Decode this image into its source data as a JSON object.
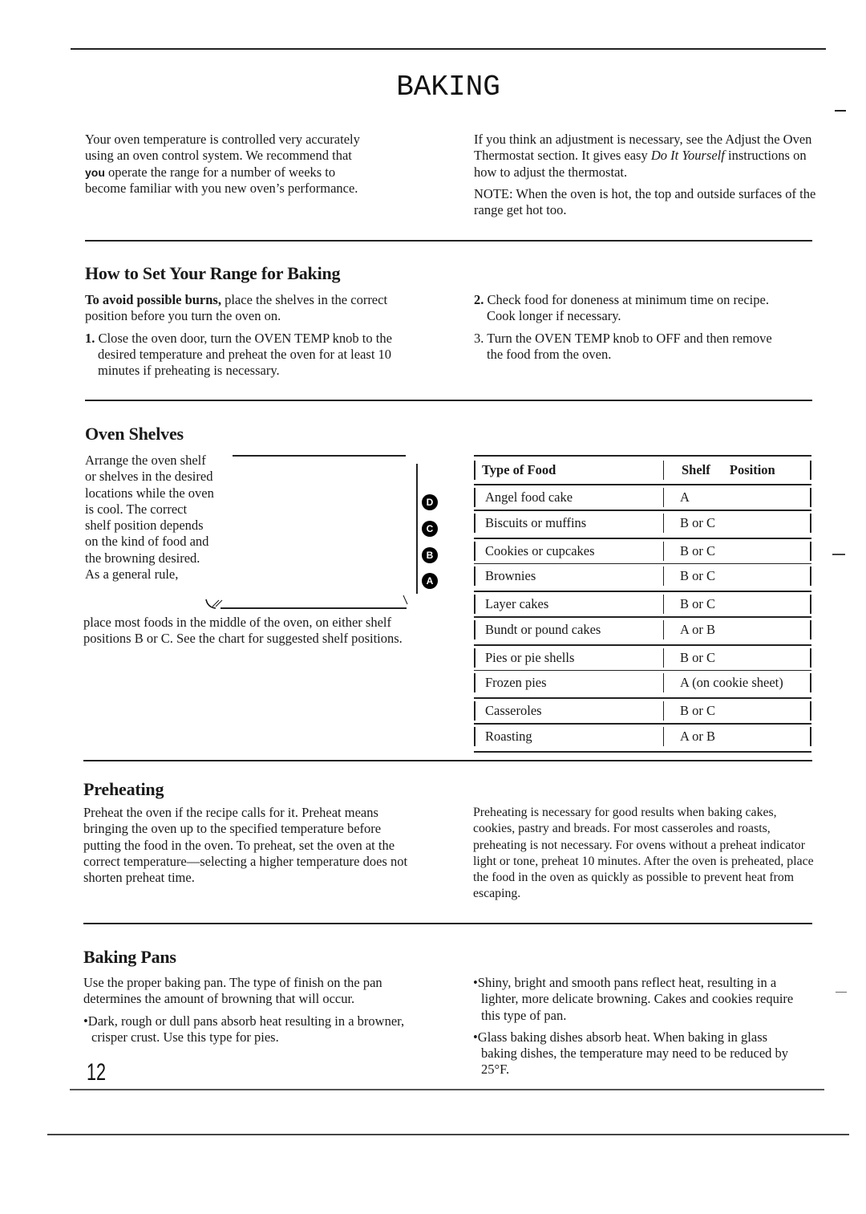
{
  "page": {
    "title": "BAKING",
    "page_number": "12"
  },
  "intro": {
    "left_line1": "Your oven temperature is controlled very accurately",
    "left_line2": "using an oven control system. We recommend that",
    "left_you": "you",
    "left_line3_rest": " operate the range for a number of weeks to",
    "left_line4": "become familiar with you new oven’s performance.",
    "right_p1_a": "If you think an adjustment is necessary, see the Adjust the Oven Thermostat section. It gives easy ",
    "right_p1_italic": "Do It Yourself",
    "right_p1_b": " instructions on how to adjust the thermostat.",
    "right_note": "NOTE: When the oven is hot, the top and outside surfaces of the range get hot too."
  },
  "how_to_set": {
    "heading": "How to Set Your Range for Baking",
    "warning_bold": "To avoid possible burns,",
    "warning_rest": " place the shelves in the correct position before you turn the oven on.",
    "steps": [
      {
        "num": "1.",
        "text": "Close the oven door, turn the OVEN TEMP knob to the desired temperature and preheat the oven for at least 10 minutes if preheating is necessary."
      },
      {
        "num": "2.",
        "text": "Check food for doneness at minimum time on recipe. Cook longer if necessary."
      },
      {
        "num": "3.",
        "text": "Turn the OVEN TEMP knob to OFF and then remove the food from the oven."
      }
    ]
  },
  "oven_shelves": {
    "heading": "Oven Shelves",
    "text_narrow": "Arrange the oven shelf or shelves in the desired locations while the oven is cool. The correct shelf position depends on the kind of food and the browning desired. As a general rule,",
    "text_wide": "place most foods in the middle of the oven, on either shelf positions B or C. See the chart for suggested shelf positions.",
    "shelf_labels": [
      "D",
      "C",
      "B",
      "A"
    ],
    "table": {
      "headers": [
        "Type of Food",
        "Shelf Position"
      ],
      "rows": [
        [
          "Angel food cake",
          "A"
        ],
        [
          "Biscuits or muffins",
          "B or C"
        ],
        [
          "Cookies or cupcakes",
          "B or C"
        ],
        [
          "Brownies",
          "B or C"
        ],
        [
          "Layer cakes",
          "B or C"
        ],
        [
          "Bundt or pound cakes",
          "A or B"
        ],
        [
          "Pies or pie shells",
          "B or C"
        ],
        [
          "Frozen pies",
          "A (on cookie sheet)"
        ],
        [
          "Casseroles",
          "B or C"
        ],
        [
          "Roasting",
          "A or B"
        ]
      ]
    }
  },
  "preheating": {
    "heading": "Preheating",
    "left": "Preheat the oven if the recipe calls for it. Preheat means bringing the oven up to the specified temperature before putting the food in the oven. To preheat, set the oven at the correct temperature—selecting a higher temperature does not shorten preheat time.",
    "right": "Preheating is necessary for good results when baking cakes, cookies, pastry and breads. For most casseroles and roasts, preheating is not necessary. For ovens without a preheat indicator light or tone, preheat 10 minutes. After the oven is preheated, place the food in the oven as quickly as possible to prevent heat from escaping."
  },
  "baking_pans": {
    "heading": "Baking Pans",
    "intro": "Use the proper baking pan. The type of finish on the pan determines the amount of browning that will occur.",
    "bullets": [
      "Dark, rough or dull pans absorb heat resulting in a browner, crisper crust. Use this type for pies.",
      "Shiny, bright and smooth pans reflect heat, resulting in a lighter, more delicate browning. Cakes and cookies require this type of pan.",
      "Glass baking dishes absorb heat. When baking in glass baking dishes, the temperature may need to be reduced by 25°F."
    ],
    "bullet_glyph": "•"
  }
}
